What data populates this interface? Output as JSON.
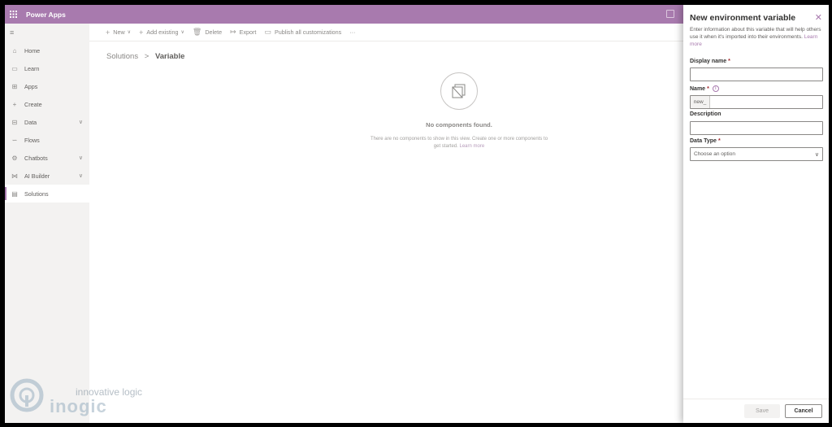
{
  "header": {
    "app_title": "Power Apps"
  },
  "sidebar": {
    "items": [
      {
        "label": "Home",
        "icon": "home-icon",
        "glyph": "⌂",
        "chevron": false,
        "active": false
      },
      {
        "label": "Learn",
        "icon": "book-icon",
        "glyph": "▭",
        "chevron": false,
        "active": false
      },
      {
        "label": "Apps",
        "icon": "apps-icon",
        "glyph": "⊞",
        "chevron": false,
        "active": false
      },
      {
        "label": "Create",
        "icon": "plus-icon",
        "glyph": "+",
        "chevron": false,
        "active": false
      },
      {
        "label": "Data",
        "icon": "table-icon",
        "glyph": "⊟",
        "chevron": true,
        "active": false
      },
      {
        "label": "Flows",
        "icon": "flow-icon",
        "glyph": "∽",
        "chevron": false,
        "active": false
      },
      {
        "label": "Chatbots",
        "icon": "chatbot-icon",
        "glyph": "⚙",
        "chevron": true,
        "active": false
      },
      {
        "label": "AI Builder",
        "icon": "ai-builder-icon",
        "glyph": "⋈",
        "chevron": true,
        "active": false
      },
      {
        "label": "Solutions",
        "icon": "solutions-icon",
        "glyph": "▤",
        "chevron": false,
        "active": true
      }
    ]
  },
  "commandbar": {
    "new": "New",
    "add_existing": "Add existing",
    "delete": "Delete",
    "export": "Export",
    "publish": "Publish all customizations",
    "more": "···"
  },
  "breadcrumb": {
    "root": "Solutions",
    "separator": ">",
    "current": "Variable"
  },
  "empty_state": {
    "title": "No components found.",
    "text": "There are no components to show in this view. Create one or more components to get started.",
    "link": "Learn more"
  },
  "panel": {
    "title": "New environment variable",
    "description": "Enter information about this variable that will help others use it when it's imported into their environments.",
    "description_link": "Learn more",
    "display_name_label": "Display name",
    "display_name_value": "",
    "name_label": "Name",
    "name_prefix": "new_",
    "name_value": "",
    "description_label": "Description",
    "description_value": "",
    "data_type_label": "Data Type",
    "data_type_placeholder": "Choose an option",
    "required_mark": "*",
    "save_label": "Save",
    "cancel_label": "Cancel"
  },
  "watermark": {
    "tagline": "innovative logic",
    "name": "inogic"
  },
  "colors": {
    "accent": "#a87aae",
    "required": "#a4262c"
  }
}
